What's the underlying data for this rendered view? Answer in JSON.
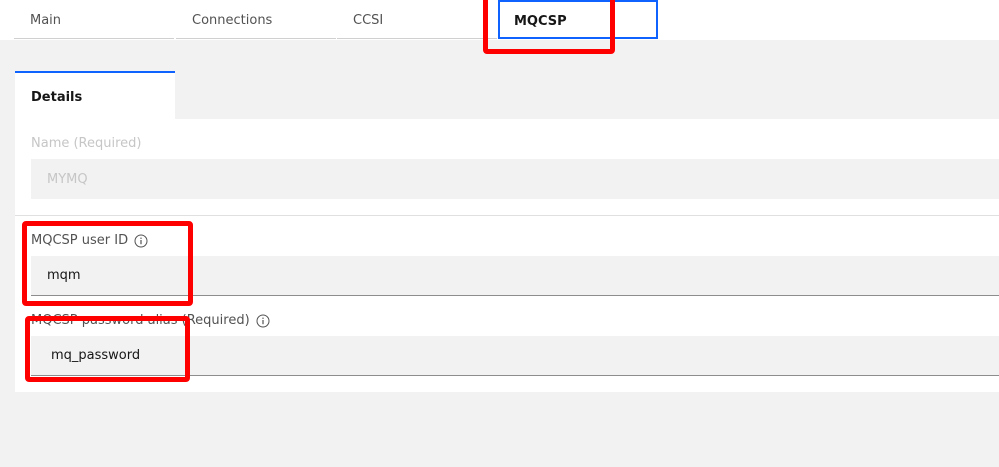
{
  "tabs": [
    {
      "label": "Main"
    },
    {
      "label": "Connections"
    },
    {
      "label": "CCSI"
    },
    {
      "label": "MQCSP"
    }
  ],
  "subtabs": {
    "active": "Details"
  },
  "form": {
    "name": {
      "label": "Name (Required)",
      "value": "MYMQ"
    },
    "user_id": {
      "label": "MQCSP user ID",
      "value": "mqm"
    },
    "password_alias": {
      "label": "MQCSP password alias (Required)",
      "value": "mq_password"
    }
  },
  "colors": {
    "accent": "#0f62fe",
    "highlight": "#ff0000"
  },
  "icons": {
    "info": "info-icon"
  }
}
